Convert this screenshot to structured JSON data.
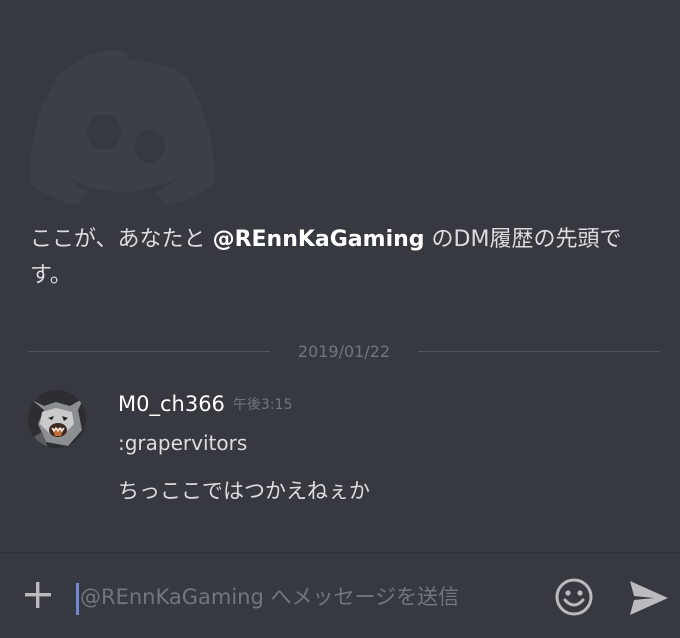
{
  "intro": {
    "prefix": "ここが、あなたと ",
    "mention": "@REnnKaGaming",
    "suffix": " のDM履歴の先頭です。"
  },
  "divider": {
    "date": "2019/01/22"
  },
  "message": {
    "author": "M0_ch366",
    "timestamp": "午後3:15",
    "lines": [
      ":grapervitors",
      "ちっここではつかえねぇか"
    ]
  },
  "composer": {
    "placeholder": "@REnnKaGaming へメッセージを送信",
    "value": ""
  },
  "icons": {
    "logo": "discord-logo-icon",
    "add": "plus-icon",
    "emoji": "smiley-icon",
    "send": "send-icon"
  },
  "colors": {
    "background": "#36393f",
    "accent": "#7289da",
    "muted": "#72767d"
  }
}
